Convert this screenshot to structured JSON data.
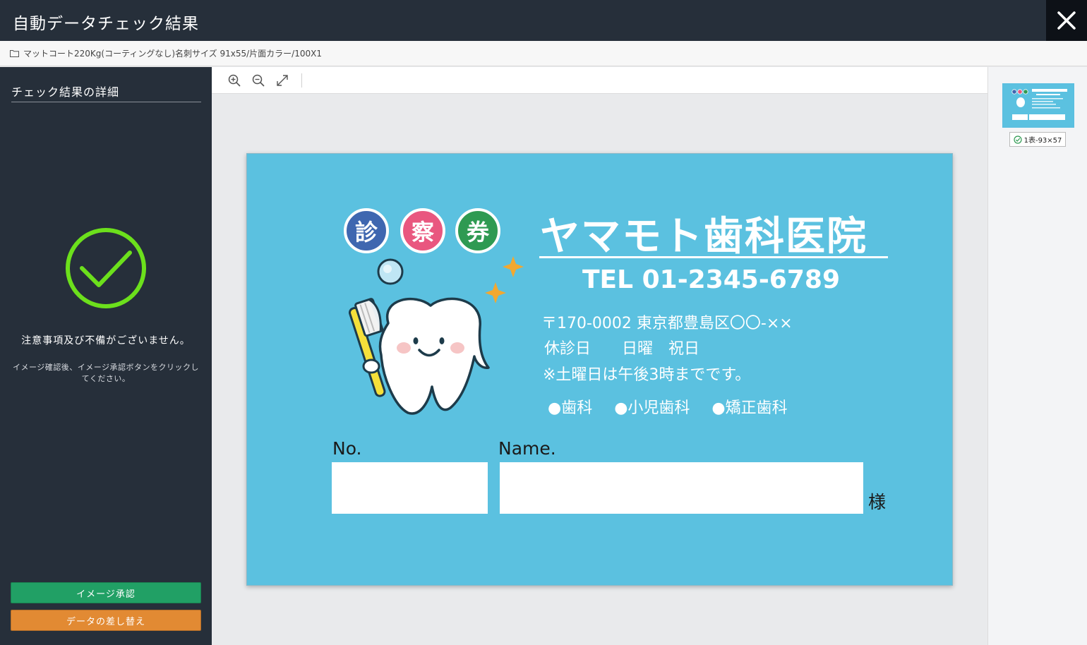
{
  "window": {
    "title": "自動データチェック結果",
    "close_icon": "close-icon"
  },
  "breadcrumb": {
    "icon": "folder-icon",
    "text": "マットコート220Kg(コーティングなし)名刺サイズ 91x55/片面カラー/100X1"
  },
  "sidebar": {
    "heading": "チェック結果の詳細",
    "status_icon": "check-circle-icon",
    "message": "注意事項及び不備がございません。",
    "instruction": "イメージ確認後、イメージ承認ボタンをクリックしてください。",
    "approve_label": "イメージ承認",
    "replace_label": "データの差し替え"
  },
  "toolbar": {
    "tools": [
      "zoom-in-icon",
      "zoom-out-icon",
      "fit-screen-icon"
    ]
  },
  "preview": {
    "badges": [
      "診",
      "察",
      "券"
    ],
    "clinic_name": "ヤマモト歯科医院",
    "tel": "TEL 01-2345-6789",
    "address": "〒170-0002 東京都豊島区〇〇-××",
    "holiday": "休診日　　日曜　祝日",
    "note": "※土曜日は午後3時までです。",
    "departments": [
      "●歯科",
      "●小児歯科",
      "●矯正歯科"
    ],
    "no_label": "No.",
    "name_label": "Name.",
    "honorific": "様"
  },
  "thumbnails": [
    {
      "label": "1表-93×57",
      "status_icon": "check-circle-icon"
    }
  ],
  "colors": {
    "header_bg": "#262f3a",
    "approve_green": "#21a065",
    "replace_orange": "#e28a33",
    "check_green": "#6ce01c",
    "card_blue": "#5bc1e0",
    "badge_blue": "#3f67b0",
    "badge_pink": "#e9577f",
    "badge_green": "#2f9a52"
  }
}
